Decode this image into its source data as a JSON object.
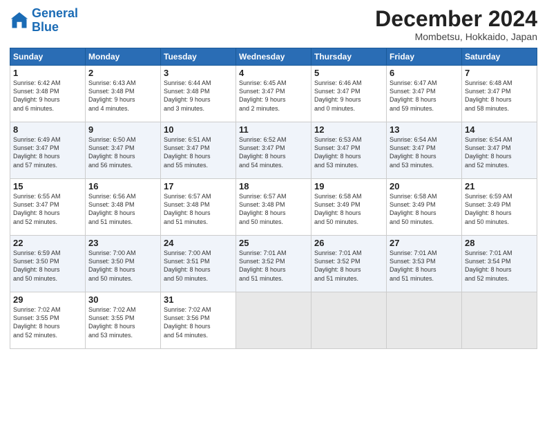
{
  "header": {
    "logo_line1": "General",
    "logo_line2": "Blue",
    "month": "December 2024",
    "location": "Mombetsu, Hokkaido, Japan"
  },
  "days_of_week": [
    "Sunday",
    "Monday",
    "Tuesday",
    "Wednesday",
    "Thursday",
    "Friday",
    "Saturday"
  ],
  "weeks": [
    [
      {
        "day": 1,
        "lines": [
          "Sunrise: 6:42 AM",
          "Sunset: 3:48 PM",
          "Daylight: 9 hours",
          "and 6 minutes."
        ]
      },
      {
        "day": 2,
        "lines": [
          "Sunrise: 6:43 AM",
          "Sunset: 3:48 PM",
          "Daylight: 9 hours",
          "and 4 minutes."
        ]
      },
      {
        "day": 3,
        "lines": [
          "Sunrise: 6:44 AM",
          "Sunset: 3:48 PM",
          "Daylight: 9 hours",
          "and 3 minutes."
        ]
      },
      {
        "day": 4,
        "lines": [
          "Sunrise: 6:45 AM",
          "Sunset: 3:47 PM",
          "Daylight: 9 hours",
          "and 2 minutes."
        ]
      },
      {
        "day": 5,
        "lines": [
          "Sunrise: 6:46 AM",
          "Sunset: 3:47 PM",
          "Daylight: 9 hours",
          "and 0 minutes."
        ]
      },
      {
        "day": 6,
        "lines": [
          "Sunrise: 6:47 AM",
          "Sunset: 3:47 PM",
          "Daylight: 8 hours",
          "and 59 minutes."
        ]
      },
      {
        "day": 7,
        "lines": [
          "Sunrise: 6:48 AM",
          "Sunset: 3:47 PM",
          "Daylight: 8 hours",
          "and 58 minutes."
        ]
      }
    ],
    [
      {
        "day": 8,
        "lines": [
          "Sunrise: 6:49 AM",
          "Sunset: 3:47 PM",
          "Daylight: 8 hours",
          "and 57 minutes."
        ]
      },
      {
        "day": 9,
        "lines": [
          "Sunrise: 6:50 AM",
          "Sunset: 3:47 PM",
          "Daylight: 8 hours",
          "and 56 minutes."
        ]
      },
      {
        "day": 10,
        "lines": [
          "Sunrise: 6:51 AM",
          "Sunset: 3:47 PM",
          "Daylight: 8 hours",
          "and 55 minutes."
        ]
      },
      {
        "day": 11,
        "lines": [
          "Sunrise: 6:52 AM",
          "Sunset: 3:47 PM",
          "Daylight: 8 hours",
          "and 54 minutes."
        ]
      },
      {
        "day": 12,
        "lines": [
          "Sunrise: 6:53 AM",
          "Sunset: 3:47 PM",
          "Daylight: 8 hours",
          "and 53 minutes."
        ]
      },
      {
        "day": 13,
        "lines": [
          "Sunrise: 6:54 AM",
          "Sunset: 3:47 PM",
          "Daylight: 8 hours",
          "and 53 minutes."
        ]
      },
      {
        "day": 14,
        "lines": [
          "Sunrise: 6:54 AM",
          "Sunset: 3:47 PM",
          "Daylight: 8 hours",
          "and 52 minutes."
        ]
      }
    ],
    [
      {
        "day": 15,
        "lines": [
          "Sunrise: 6:55 AM",
          "Sunset: 3:47 PM",
          "Daylight: 8 hours",
          "and 52 minutes."
        ]
      },
      {
        "day": 16,
        "lines": [
          "Sunrise: 6:56 AM",
          "Sunset: 3:48 PM",
          "Daylight: 8 hours",
          "and 51 minutes."
        ]
      },
      {
        "day": 17,
        "lines": [
          "Sunrise: 6:57 AM",
          "Sunset: 3:48 PM",
          "Daylight: 8 hours",
          "and 51 minutes."
        ]
      },
      {
        "day": 18,
        "lines": [
          "Sunrise: 6:57 AM",
          "Sunset: 3:48 PM",
          "Daylight: 8 hours",
          "and 50 minutes."
        ]
      },
      {
        "day": 19,
        "lines": [
          "Sunrise: 6:58 AM",
          "Sunset: 3:49 PM",
          "Daylight: 8 hours",
          "and 50 minutes."
        ]
      },
      {
        "day": 20,
        "lines": [
          "Sunrise: 6:58 AM",
          "Sunset: 3:49 PM",
          "Daylight: 8 hours",
          "and 50 minutes."
        ]
      },
      {
        "day": 21,
        "lines": [
          "Sunrise: 6:59 AM",
          "Sunset: 3:49 PM",
          "Daylight: 8 hours",
          "and 50 minutes."
        ]
      }
    ],
    [
      {
        "day": 22,
        "lines": [
          "Sunrise: 6:59 AM",
          "Sunset: 3:50 PM",
          "Daylight: 8 hours",
          "and 50 minutes."
        ]
      },
      {
        "day": 23,
        "lines": [
          "Sunrise: 7:00 AM",
          "Sunset: 3:50 PM",
          "Daylight: 8 hours",
          "and 50 minutes."
        ]
      },
      {
        "day": 24,
        "lines": [
          "Sunrise: 7:00 AM",
          "Sunset: 3:51 PM",
          "Daylight: 8 hours",
          "and 50 minutes."
        ]
      },
      {
        "day": 25,
        "lines": [
          "Sunrise: 7:01 AM",
          "Sunset: 3:52 PM",
          "Daylight: 8 hours",
          "and 51 minutes."
        ]
      },
      {
        "day": 26,
        "lines": [
          "Sunrise: 7:01 AM",
          "Sunset: 3:52 PM",
          "Daylight: 8 hours",
          "and 51 minutes."
        ]
      },
      {
        "day": 27,
        "lines": [
          "Sunrise: 7:01 AM",
          "Sunset: 3:53 PM",
          "Daylight: 8 hours",
          "and 51 minutes."
        ]
      },
      {
        "day": 28,
        "lines": [
          "Sunrise: 7:01 AM",
          "Sunset: 3:54 PM",
          "Daylight: 8 hours",
          "and 52 minutes."
        ]
      }
    ],
    [
      {
        "day": 29,
        "lines": [
          "Sunrise: 7:02 AM",
          "Sunset: 3:55 PM",
          "Daylight: 8 hours",
          "and 52 minutes."
        ]
      },
      {
        "day": 30,
        "lines": [
          "Sunrise: 7:02 AM",
          "Sunset: 3:55 PM",
          "Daylight: 8 hours",
          "and 53 minutes."
        ]
      },
      {
        "day": 31,
        "lines": [
          "Sunrise: 7:02 AM",
          "Sunset: 3:56 PM",
          "Daylight: 8 hours",
          "and 54 minutes."
        ]
      },
      null,
      null,
      null,
      null
    ]
  ]
}
